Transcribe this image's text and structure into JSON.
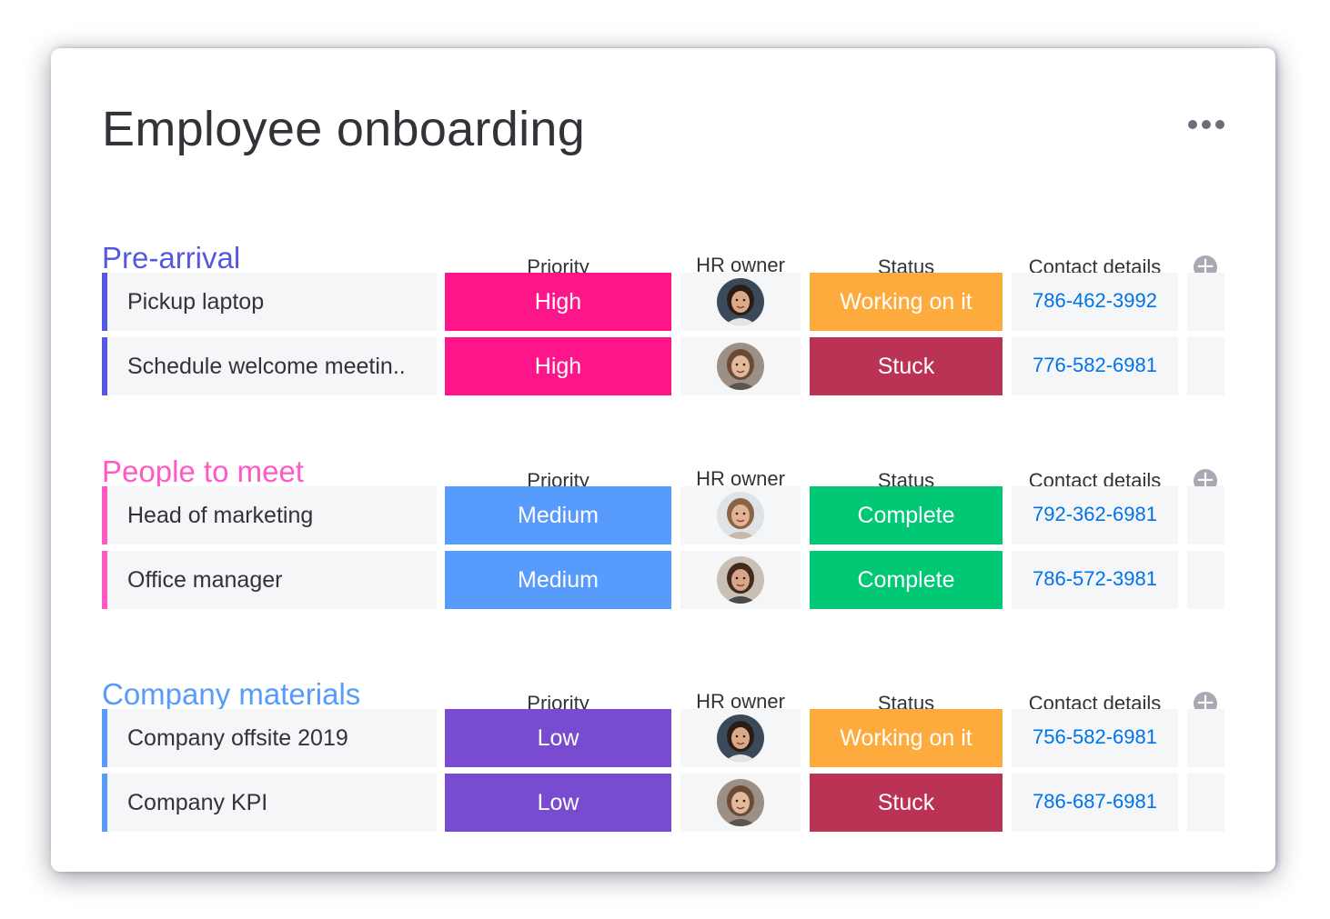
{
  "board": {
    "title": "Employee onboarding",
    "more_icon": "more-horizontal-icon"
  },
  "columns": {
    "priority": "Priority",
    "owner": "HR owner",
    "status": "Status",
    "contact": "Contact details",
    "add_icon": "plus-circle-icon"
  },
  "colors": {
    "high": "#ff158a",
    "medium": "#579bfc",
    "low": "#784bd1",
    "working": "#fdab3d",
    "stuck": "#bb3354",
    "complete": "#00c875",
    "link": "#0073ea"
  },
  "groups": [
    {
      "name": "Pre-arrival",
      "color": "#5559df",
      "rows": [
        {
          "task": "Pickup laptop",
          "priority": "High",
          "priority_color": "#ff158a",
          "owner_avatar": "avatar-woman-dark-hair",
          "status": "Working on it",
          "status_color": "#fdab3d",
          "contact": "786-462-3992"
        },
        {
          "task": "Schedule welcome meetin..",
          "priority": "High",
          "priority_color": "#ff158a",
          "owner_avatar": "avatar-woman-smiling",
          "status": "Stuck",
          "status_color": "#bb3354",
          "contact": "776-582-6981"
        }
      ]
    },
    {
      "name": "People to meet",
      "color": "#ff5ac4",
      "rows": [
        {
          "task": "Head of marketing",
          "priority": "Medium",
          "priority_color": "#579bfc",
          "owner_avatar": "avatar-woman-long-hair",
          "status": "Complete",
          "status_color": "#00c875",
          "contact": "792-362-6981"
        },
        {
          "task": "Office manager",
          "priority": "Medium",
          "priority_color": "#579bfc",
          "owner_avatar": "avatar-woman-smiling-2",
          "status": "Complete",
          "status_color": "#00c875",
          "contact": "786-572-3981"
        }
      ]
    },
    {
      "name": "Company materials",
      "color": "#579bfc",
      "rows": [
        {
          "task": "Company offsite 2019",
          "priority": "Low",
          "priority_color": "#784bd1",
          "owner_avatar": "avatar-woman-dark-hair",
          "status": "Working on it",
          "status_color": "#fdab3d",
          "contact": "756-582-6981"
        },
        {
          "task": "Company KPI",
          "priority": "Low",
          "priority_color": "#784bd1",
          "owner_avatar": "avatar-woman-smiling",
          "status": "Stuck",
          "status_color": "#bb3354",
          "contact": "786-687-6981"
        }
      ]
    }
  ]
}
